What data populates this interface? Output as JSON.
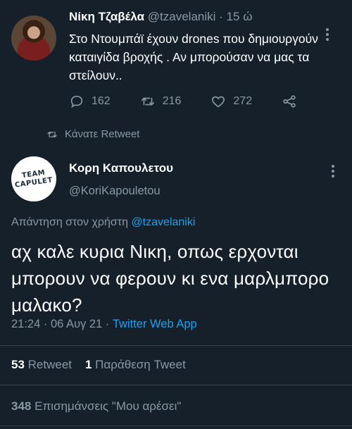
{
  "tweet1": {
    "name": "Νίκη Τζαβέλα",
    "handle": "@tzavelaniki",
    "separator": "·",
    "time": "15 ώ",
    "text": "Στο Ντουμπάϊ έχουν drones που δημιουργούν καταιγίδα βροχής . Αν μπορούσαν να μας τα στείλουν..",
    "replies": "162",
    "retweets": "216",
    "likes": "272"
  },
  "retweet_note": "Κάνατε Retweet",
  "tweet2": {
    "avatar_line1": "TEAM",
    "avatar_line2": "CAPULET",
    "name": "Κορη Καπουλετου",
    "handle": "@KoriKapouletou",
    "reply_prefix": "Απάντηση στον χρήστη",
    "reply_handle": "@tzavelaniki",
    "text": "αχ καλε κυρια Νικη, οπως ερχονται μπορουν να φερουν κι ενα μαρλμπορο μαλακο?",
    "timestamp": "21:24 · 06 Αυγ 21 · ",
    "source": "Twitter Web App",
    "retweet_count": "53",
    "retweet_label": "Retweet",
    "quote_count": "1",
    "quote_label": "Παράθεση Tweet",
    "likes_count": "348",
    "likes_label": "Επισημάνσεις \"Μου αρέσει\""
  },
  "colors": {
    "background": "#15202b",
    "muted": "#8899a6",
    "link": "#1da1f2",
    "divider": "#38444d"
  }
}
